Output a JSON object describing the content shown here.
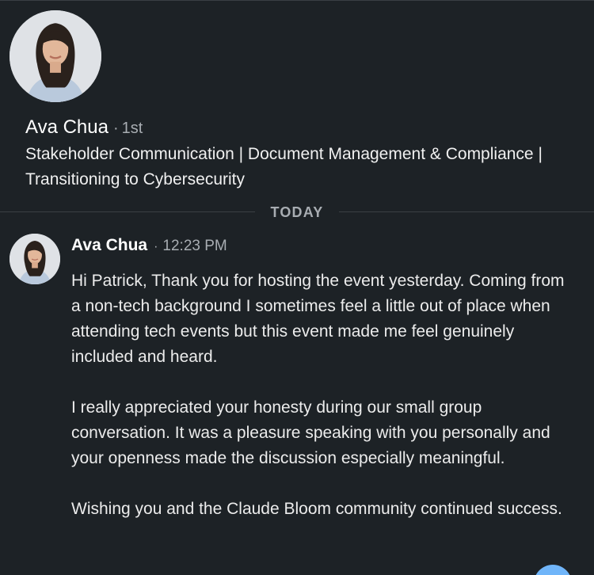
{
  "profile": {
    "name": "Ava Chua",
    "separator": "·",
    "degree": "1st",
    "headline": "Stakeholder Communication | Document Management & Compliance | Transitioning to Cybersecurity",
    "avatar_icon": "profile-photo"
  },
  "divider": {
    "label": "TODAY"
  },
  "message": {
    "sender": "Ava Chua",
    "separator": "·",
    "time": "12:23 PM",
    "paragraphs": [
      "Hi Patrick, Thank you for hosting the event yesterday. Coming from a non-tech background I sometimes feel a little out of place when attending tech events but this event made me feel genuinely included and heard.",
      "I really appreciated your honesty during our small group conversation. It was a pleasure speaking with you personally and your openness made the discussion especially meaningful.",
      "Wishing you and the Claude Bloom community continued success."
    ]
  },
  "colors": {
    "background": "#1d2226",
    "text": "#e9e9e9",
    "muted": "#a8adb2",
    "accent": "#70b5f9"
  }
}
